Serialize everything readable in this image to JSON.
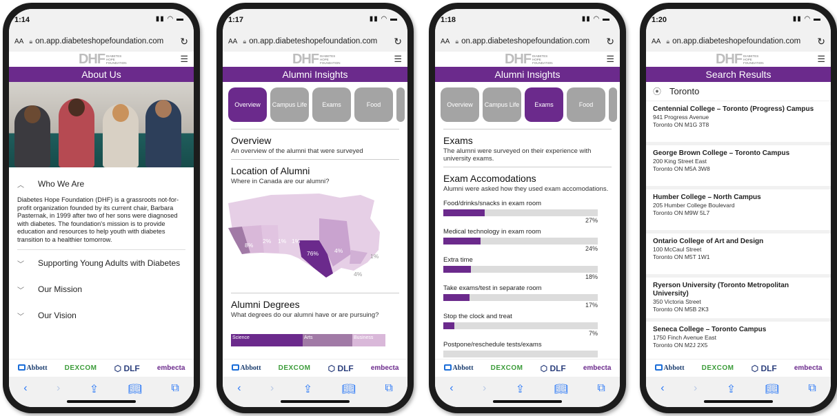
{
  "common": {
    "url": "on.app.diabeteshopefoundation.com",
    "aa_label": "AA",
    "logo_letters": "DHF",
    "logo_sub": "DIABETES HOPE FOUNDATION",
    "sponsors": [
      "Abbott",
      "DEXCOM",
      "DLF",
      "embecta"
    ]
  },
  "phone1": {
    "time": "1:14",
    "title": "About Us",
    "open_section": {
      "label": "Who We Are",
      "body": "Diabetes Hope Foundation (DHF) is a grassroots not-for-profit organization founded by its current chair, Barbara Pasternak, in 1999 after two of her sons were diagnosed with diabetes. The foundation's mission is to provide education and resources to help youth with diabetes transition to a healthier tomorrow."
    },
    "sections": [
      "Supporting Young Adults with Diabetes",
      "Our Mission",
      "Our Vision"
    ]
  },
  "phone2": {
    "time": "1:17",
    "title": "Alumni Insights",
    "tabs": [
      "Overview",
      "Campus Life",
      "Exams",
      "Food"
    ],
    "active_tab": "Overview",
    "overview_title": "Overview",
    "overview_desc": "An overview of the alumni that were surveyed",
    "location_title": "Location of Alumni",
    "location_desc": "Where in Canada are our alumni?",
    "map_labels": [
      "8%",
      "2%",
      "1%",
      "1%",
      "76%",
      "4%",
      "1%",
      "4%"
    ],
    "degrees_title": "Alumni Degrees",
    "degrees_desc": "What degrees do our alumni have or are pursuing?",
    "degree_bar": [
      "Science",
      "Arts",
      "Business"
    ]
  },
  "phone3": {
    "time": "1:18",
    "title": "Alumni Insights",
    "tabs": [
      "Overview",
      "Campus Life",
      "Exams",
      "Food"
    ],
    "active_tab": "Exams",
    "exams_title": "Exams",
    "exams_desc": "The alumni were surveyed on their experience with university exams.",
    "acc_title": "Exam Accomodations",
    "acc_desc": "Alumni were asked how they used exam accomodations.",
    "bars": [
      {
        "label": "Food/drinks/snacks in exam room",
        "pct": "27%",
        "value": 27
      },
      {
        "label": "Medical technology in exam room",
        "pct": "24%",
        "value": 24
      },
      {
        "label": "Extra time",
        "pct": "18%",
        "value": 18
      },
      {
        "label": "Take exams/test in separate room",
        "pct": "17%",
        "value": 17
      },
      {
        "label": "Stop the clock and treat",
        "pct": "7%",
        "value": 7
      },
      {
        "label": "Postpone/reschedule tests/exams",
        "pct": "",
        "value": 0
      }
    ]
  },
  "phone4": {
    "time": "1:20",
    "title": "Search Results",
    "search_value": "Toronto",
    "results": [
      {
        "name": "Centennial College – Toronto (Progress) Campus",
        "addr1": "941 Progress Avenue",
        "addr2": "Toronto ON M1G 3T8"
      },
      {
        "name": "George Brown College – Toronto Campus",
        "addr1": "200 King Street East",
        "addr2": "Toronto ON M5A 3W8"
      },
      {
        "name": "Humber College – North Campus",
        "addr1": "205 Humber College Boulevard",
        "addr2": "Toronto ON M9W 5L7"
      },
      {
        "name": "Ontario College of Art and Design",
        "addr1": "100 McCaul Street",
        "addr2": "Toronto ON M5T 1W1"
      },
      {
        "name": "Ryerson University (Toronto Metropolitan University)",
        "addr1": "350 Victoria Street",
        "addr2": "Toronto ON M5B 2K3"
      },
      {
        "name": "Seneca College – Toronto Campus",
        "addr1": "1750 Finch Avenue East",
        "addr2": "Toronto ON M2J 2X5"
      }
    ]
  },
  "colors": {
    "brand_purple": "#6b2a8c",
    "tab_gray": "#a4a4a4",
    "ios_blue": "#2f7bf6"
  }
}
